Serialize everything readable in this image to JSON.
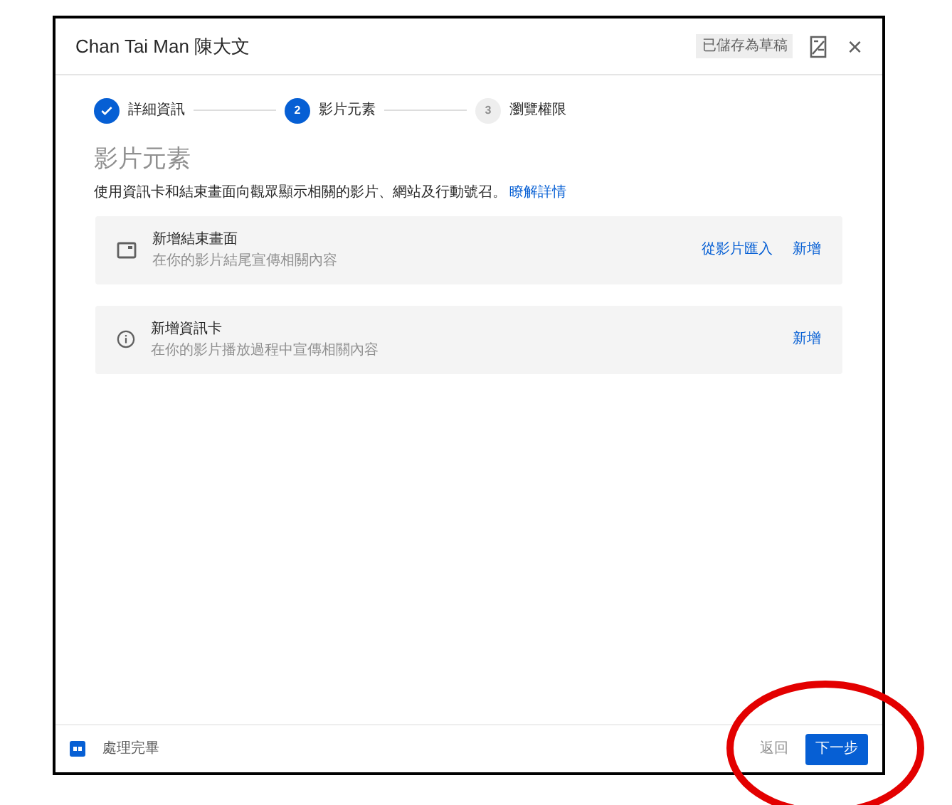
{
  "dialog": {
    "title": "Chan Tai Man 陳大文",
    "saved_badge": "已儲存為草稿",
    "close": "×"
  },
  "steps": [
    {
      "label": "詳細資訊",
      "done": true,
      "selected": false
    },
    {
      "number": "2",
      "label": "影片元素",
      "done": false,
      "selected": true
    },
    {
      "number": "3",
      "label": "瀏覽權限",
      "done": false,
      "selected": false
    }
  ],
  "section": {
    "heading": "影片元素",
    "description": "使用資訊卡和結束畫面向觀眾顯示相關的影片、網站及行動號召。",
    "link": "瞭解詳情"
  },
  "cards": [
    {
      "kind": "endscreen",
      "title": "新增結束畫面",
      "subtitle": "在你的影片結尾宣傳相關內容",
      "actions": [
        "從影片匯入",
        "新增"
      ]
    },
    {
      "kind": "info",
      "title": "新增資訊卡",
      "subtitle": "在你的影片播放過程中宣傳相關內容",
      "actions": [
        "新增"
      ]
    }
  ],
  "footer": {
    "status": "處理完畢",
    "back": "返回",
    "next": "下一步"
  },
  "annotation": {
    "kind": "circle"
  }
}
